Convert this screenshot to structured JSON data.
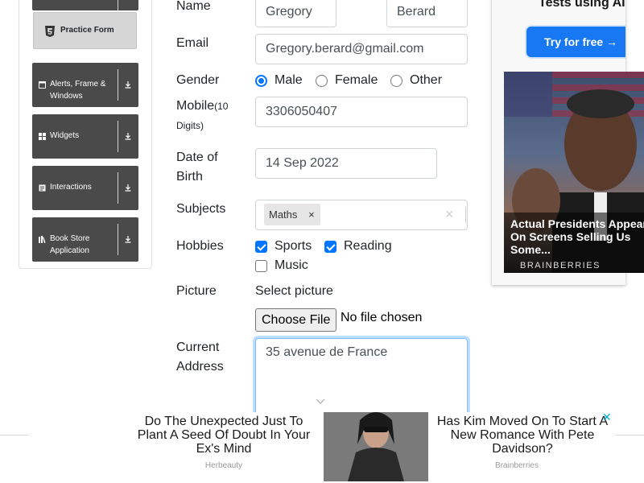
{
  "sidebar": {
    "practice_form_label": "Practice Form",
    "groups": [
      {
        "label_line1": "Alerts, Frame &",
        "label_line2": "Windows"
      },
      {
        "label": "Widgets"
      },
      {
        "label": "Interactions"
      },
      {
        "label_line1": "Book Store",
        "label_line2": "Application"
      }
    ]
  },
  "form": {
    "name_label": "Name",
    "first_name": "Gregory",
    "last_name": "Berard",
    "email_label": "Email",
    "email": "Gregory.berard@gmail.com",
    "gender_label": "Gender",
    "gender_options": [
      "Male",
      "Female",
      "Other"
    ],
    "gender_selected": "Male",
    "mobile_label": "Mobile",
    "mobile_hint": "(10",
    "mobile_hint2": "Digits)",
    "mobile": "3306050407",
    "dob_label_line1": "Date of",
    "dob_label_line2": "Birth",
    "dob": "14 Sep 2022",
    "subjects_label": "Subjects",
    "subject_chip": "Maths",
    "chip_remove": "×",
    "clear_all": "×",
    "hobbies_label": "Hobbies",
    "hobbies": [
      {
        "label": "Sports",
        "checked": true
      },
      {
        "label": "Reading",
        "checked": true
      },
      {
        "label": "Music",
        "checked": false
      }
    ],
    "picture_label": "Picture",
    "select_picture": "Select picture",
    "choose_file": "Choose File",
    "no_file": "No file chosen",
    "address_label_line1": "Current",
    "address_label_line2": "Address",
    "address": "35 avenue de France"
  },
  "ad_right": {
    "top_text": "Tests using AI",
    "button": "Try for free →",
    "caption": "Actual Presidents Appear On Screens Selling Us Some...",
    "brand": "BRAINBERRIES"
  },
  "ad_bottom": {
    "left_text": "Do The Unexpected Just To Plant A Seed Of Doubt In Your Ex's Mind",
    "left_source": "Herbeauty",
    "right_text": "Has Kim Moved On To Start A New Romance With Pete Davidson?",
    "right_source": "Brainberries",
    "close": "✕"
  },
  "colors": {
    "accent": "#0075ff",
    "sidebar_head": "#4a4a4a",
    "ad_button": "#1877f2"
  }
}
